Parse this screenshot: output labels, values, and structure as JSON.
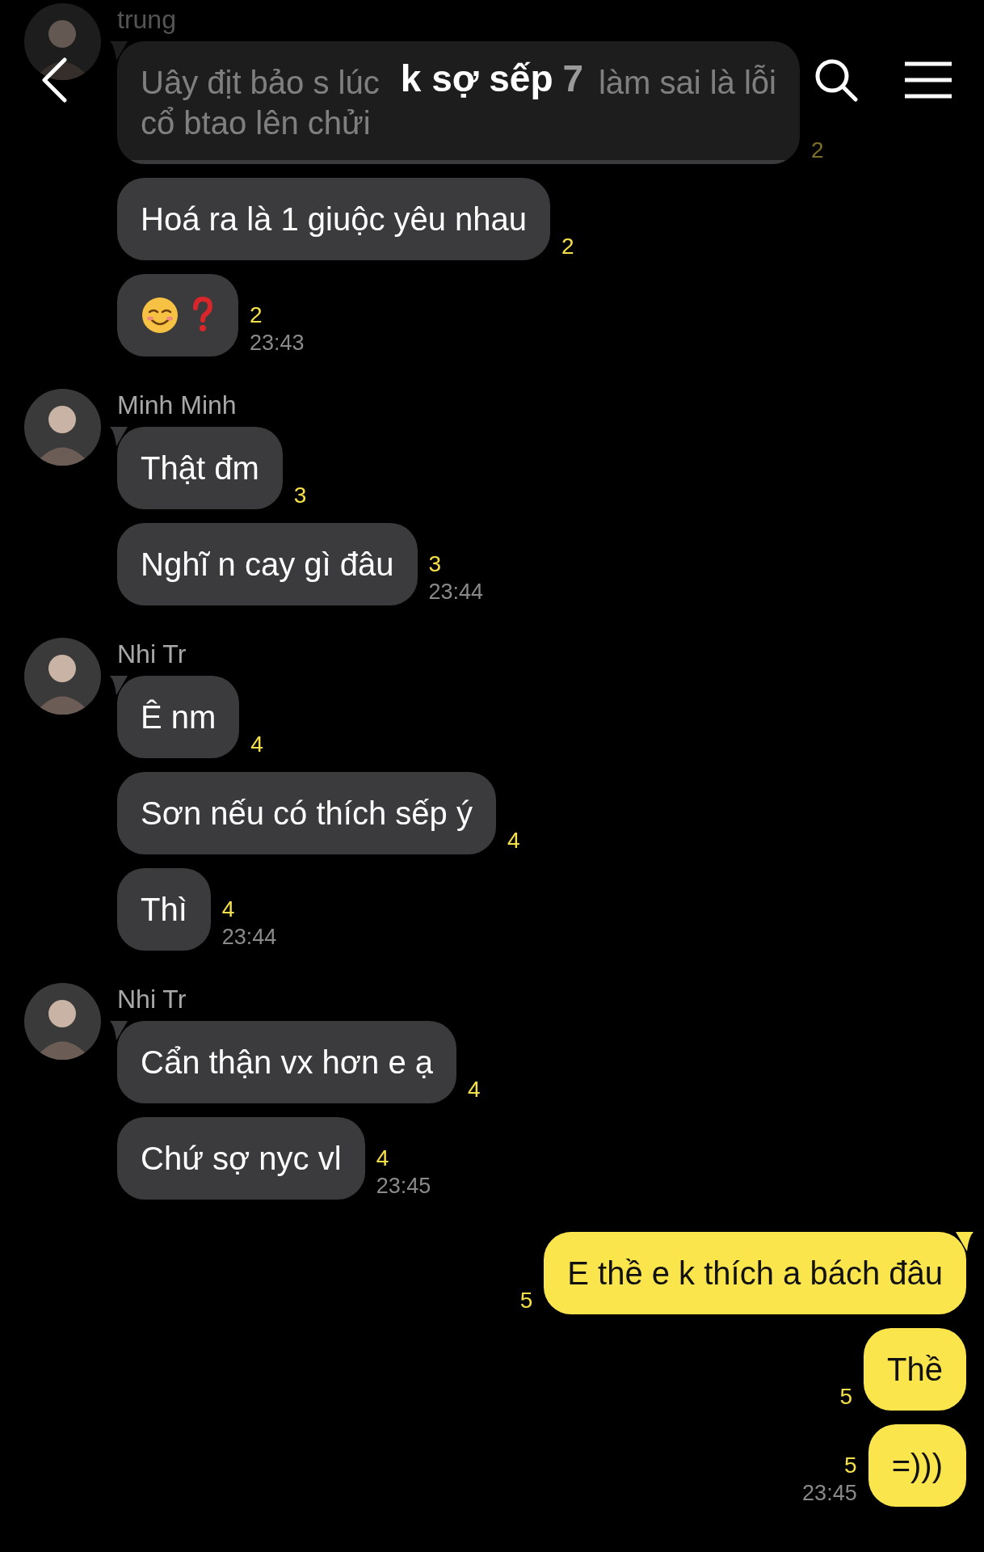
{
  "header": {
    "title": "k sợ sếp",
    "member_count": "7"
  },
  "groups": [
    {
      "kind": "incoming",
      "sender": "trung",
      "messages": [
        {
          "kind": "covered",
          "lines": [
            [
              "Uây địt bảo s lúc",
              "làm sai là lỗi"
            ],
            [
              "cổ btao lên chửi"
            ]
          ],
          "read": "2"
        },
        {
          "kind": "text",
          "text": "Hoá ra là 1 giuộc yêu nhau",
          "read": "2"
        },
        {
          "kind": "emoji",
          "read": "2",
          "time": "23:43"
        }
      ]
    },
    {
      "kind": "incoming",
      "sender": "Minh Minh",
      "messages": [
        {
          "kind": "text",
          "text": "Thật đm",
          "read": "3"
        },
        {
          "kind": "text",
          "text": "Nghĩ n cay gì đâu",
          "read": "3",
          "time": "23:44"
        }
      ]
    },
    {
      "kind": "incoming",
      "sender": "Nhi Tr",
      "messages": [
        {
          "kind": "text",
          "text": "Ê nm",
          "read": "4"
        },
        {
          "kind": "text",
          "text": "Sơn nếu có thích sếp ý",
          "read": "4"
        },
        {
          "kind": "text",
          "text": "Thì",
          "read": "4",
          "time": "23:44"
        }
      ]
    },
    {
      "kind": "incoming",
      "sender": "Nhi Tr",
      "messages": [
        {
          "kind": "text",
          "text": "Cẩn thận vx hơn e ạ",
          "read": "4"
        },
        {
          "kind": "text",
          "text": "Chứ sợ nyc vl",
          "read": "4",
          "time": "23:45"
        }
      ]
    },
    {
      "kind": "outgoing",
      "messages": [
        {
          "kind": "text",
          "text": "E thề e k thích a bách đâu",
          "read": "5"
        },
        {
          "kind": "text",
          "text": "Thề",
          "read": "5"
        },
        {
          "kind": "text",
          "text": "=)))",
          "read": "5",
          "time": "23:45"
        }
      ]
    }
  ]
}
